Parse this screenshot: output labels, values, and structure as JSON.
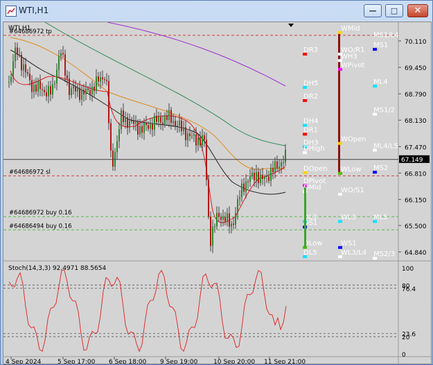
{
  "window": {
    "title": "WTI,H1",
    "buttons": {
      "minimize": "—",
      "maximize": "□",
      "close": "✕"
    }
  },
  "main": {
    "symbol_label": "WTI,H1",
    "current_price": "67.149",
    "price_ticks": [
      "70.110",
      "69.450",
      "68.790",
      "68.130",
      "67.470",
      "66.810",
      "66.150",
      "65.500",
      "64.840"
    ],
    "time_ticks": [
      "4 Sep 2024",
      "5 Sep 17:00",
      "6 Sep 18:00",
      "9 Sep 19:00",
      "10 Sep 20:00",
      "11 Sep 21:00"
    ],
    "order_lines": [
      {
        "label": "#64686972 tp",
        "price": 70.25,
        "color": "#d04040"
      },
      {
        "label": "#64686972 sl",
        "price": 66.74,
        "color": "#d04040"
      },
      {
        "label": "#64686972 buy 0.16",
        "price": 65.72,
        "color": "#59b84f"
      },
      {
        "label": "#64686494 buy 0.16",
        "price": 65.39,
        "color": "#59b84f"
      }
    ],
    "daily_levels": [
      {
        "label": "DR3",
        "price": 69.78,
        "color": "#ff0000",
        "text_color": "#ffffff"
      },
      {
        "label": "DH5",
        "price": 68.95,
        "color": "#00e5ff",
        "text_color": "#ffffff"
      },
      {
        "label": "DR2",
        "price": 68.62,
        "color": "#ff0000",
        "text_color": "#ffffff"
      },
      {
        "label": "DH4",
        "price": 68.0,
        "color": "#00e5ff",
        "text_color": "#ffffff"
      },
      {
        "label": "DR1",
        "price": 67.78,
        "color": "#ff0000",
        "text_color": "#ffffff"
      },
      {
        "label": "DH3",
        "price": 67.47,
        "color": "#00e5ff",
        "text_color": "#ffffff"
      },
      {
        "label": "DHigh",
        "price": 67.32,
        "color": "#ffffff",
        "text_color": "#ffffff"
      },
      {
        "label": "DOpen",
        "price": 66.82,
        "color": "#ffd400",
        "text_color": "#ffffff"
      },
      {
        "label": "DPivot",
        "price": 66.5,
        "color": "#ff00ff",
        "text_color": "#ffffff"
      },
      {
        "label": "DMid",
        "price": 66.35,
        "color": "#ffffff",
        "text_color": "#ffffff"
      },
      {
        "label": "DL3",
        "price": 65.6,
        "color": "#00e5ff",
        "text_color": "#ffffff"
      },
      {
        "label": "DS1",
        "price": 65.46,
        "color": "#0000ff",
        "text_color": "#ffffff"
      },
      {
        "label": "DLow",
        "price": 64.95,
        "color": "#50c000",
        "text_color": "#ffffff"
      },
      {
        "label": "DL5",
        "price": 64.72,
        "color": "#00e5ff",
        "text_color": "#ffffff"
      }
    ],
    "weekly_levels": [
      {
        "label": "WMid",
        "price": 70.32,
        "color": "#ffd400"
      },
      {
        "label": "WO/R1",
        "price": 69.78,
        "color": "#ffffff"
      },
      {
        "label": "WH3",
        "price": 69.62,
        "color": "#ffffff"
      },
      {
        "label": "WPivot",
        "price": 69.4,
        "color": "#ff00ff"
      },
      {
        "label": "WOpen",
        "price": 67.55,
        "color": "#ffd400"
      },
      {
        "label": "WLow",
        "price": 66.8,
        "color": "#50c000"
      },
      {
        "label": "WO/S1",
        "price": 66.28,
        "color": "#ffffff"
      },
      {
        "label": "WL3",
        "price": 65.6,
        "color": "#00e5ff"
      },
      {
        "label": "WS1",
        "price": 64.95,
        "color": "#0000ff"
      },
      {
        "label": "WL3/L4",
        "price": 64.72,
        "color": "#ffffff"
      }
    ],
    "monthly_levels": [
      {
        "label": "MS1/L4",
        "price": 70.15,
        "color": "#ffffff",
        "dot": false
      },
      {
        "label": "MS1",
        "price": 69.9,
        "color": "#0000ff",
        "dot": true
      },
      {
        "label": "ML4",
        "price": 68.98,
        "color": "#00e5ff",
        "dot": true
      },
      {
        "label": "MS1/2",
        "price": 68.28,
        "color": "#ffffff",
        "dot": true
      },
      {
        "label": "ML4/L5",
        "price": 67.38,
        "color": "#ffffff",
        "dot": true
      },
      {
        "label": "MS2",
        "price": 66.83,
        "color": "#0000ff",
        "dot": true
      },
      {
        "label": "ML5",
        "price": 65.6,
        "color": "#00e5ff",
        "dot": true
      },
      {
        "label": "MS2/3",
        "price": 64.68,
        "color": "#ffffff",
        "dot": true
      }
    ]
  },
  "indicator": {
    "label": "Stoch(14,3,3) 92.4971 88.5654",
    "ticks": [
      "100",
      "80",
      "76.4",
      "23.6",
      "20",
      "0"
    ]
  }
}
